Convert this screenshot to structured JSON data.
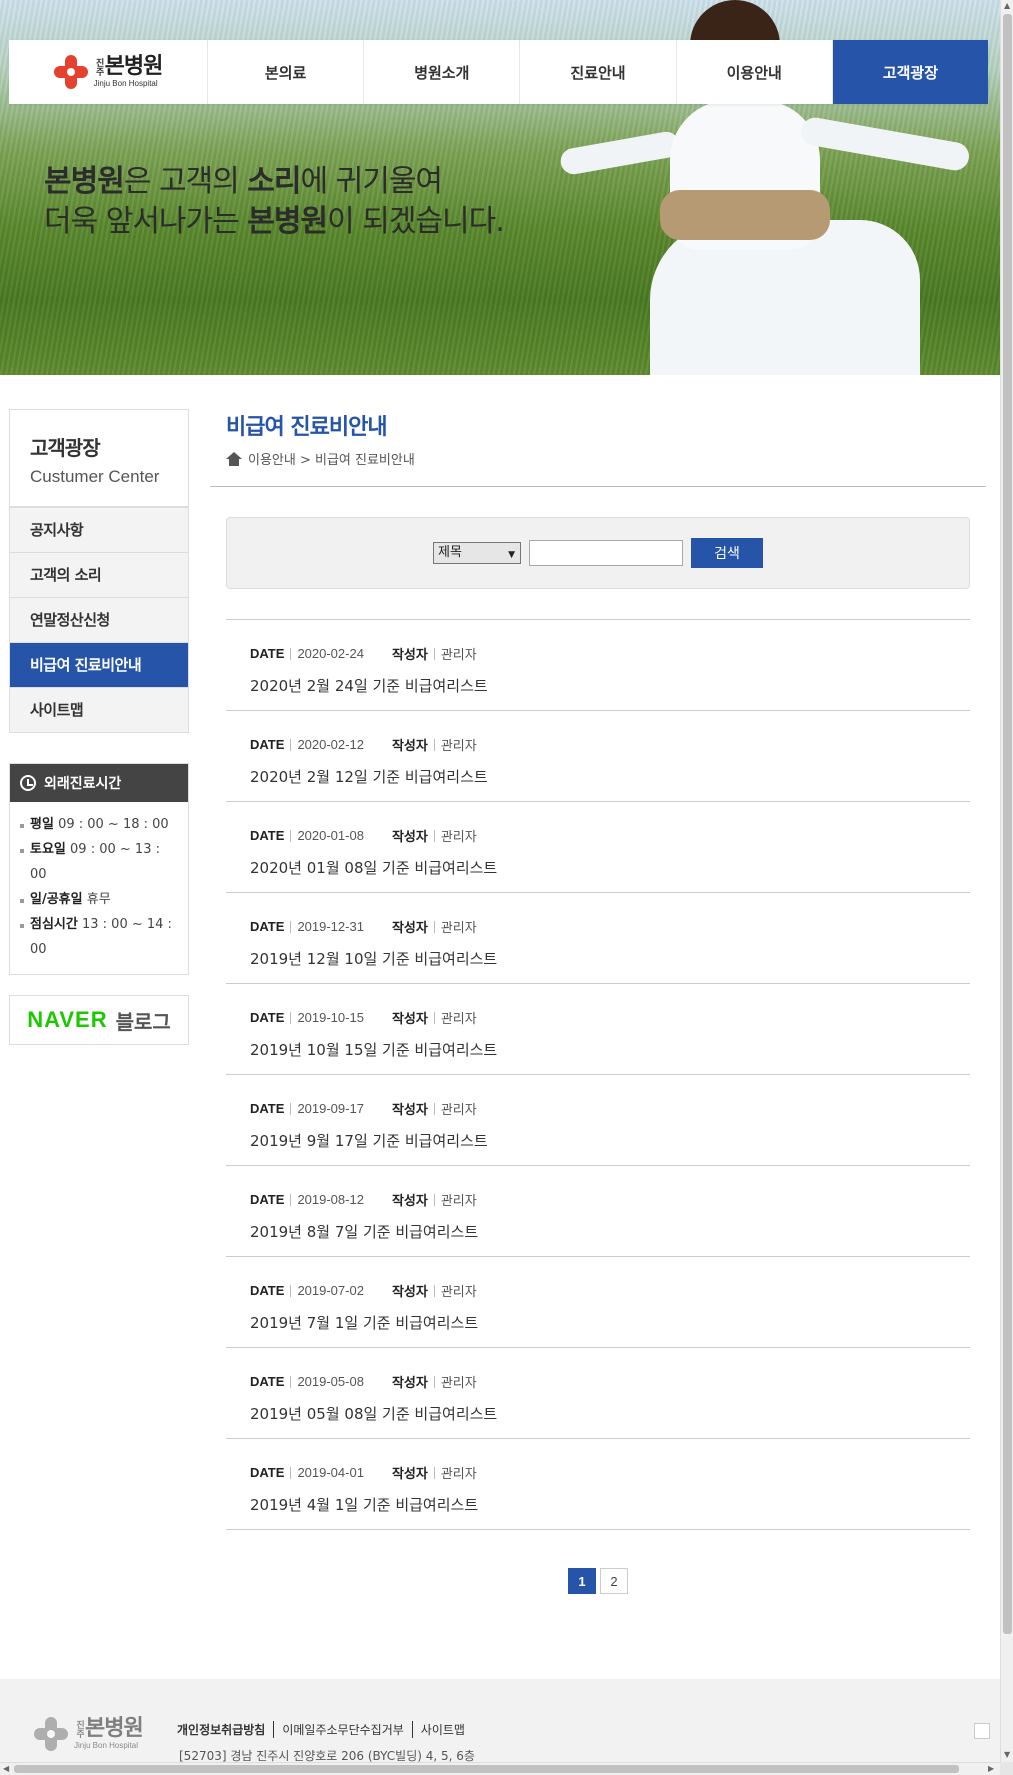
{
  "header": {
    "logo": {
      "name": "본병원",
      "prefix": "진주",
      "english": "Jinju Bon Hospital"
    },
    "nav": [
      "본의료",
      "병원소개",
      "진료안내",
      "이용안내",
      "고객광장"
    ],
    "active_nav": "고객광장"
  },
  "hero": {
    "line1_b1": "본병원",
    "line1_t1": "은 고객의 ",
    "line1_b2": "소리",
    "line1_t2": "에 귀기울여",
    "line2_t1": "더욱 앞서나가는 ",
    "line2_b1": "본병원",
    "line2_t2": "이 되겠습니다."
  },
  "sidebar": {
    "title_ko": "고객광장",
    "title_en": "Custumer Center",
    "items": [
      "공지사항",
      "고객의 소리",
      "연말정산신청",
      "비급여 진료비안내",
      "사이트맵"
    ],
    "active": "비급여 진료비안내",
    "hours": {
      "title": "외래진료시간",
      "rows": [
        {
          "label": "평일",
          "value": "09 : 00 ~ 18 : 00"
        },
        {
          "label": "토요일",
          "value": "09 : 00 ~ 13 : 00"
        },
        {
          "label": "일/공휴일",
          "value": "휴무"
        },
        {
          "label": "점심시간",
          "value": "13 : 00 ~ 14 : 00"
        }
      ]
    },
    "naver": {
      "brand": "NAVER",
      "label": "블로그"
    }
  },
  "content": {
    "title": "비급여 진료비안내",
    "breadcrumb": "이용안내 > 비급여 진료비안내",
    "search": {
      "select_value": "제목",
      "input_value": "",
      "button": "검색"
    },
    "meta_labels": {
      "date": "DATE",
      "author": "작성자"
    },
    "posts": [
      {
        "date": "2020-02-24",
        "author": "관리자",
        "title": "2020년 2월 24일 기준 비급여리스트"
      },
      {
        "date": "2020-02-12",
        "author": "관리자",
        "title": "2020년 2월 12일 기준 비급여리스트"
      },
      {
        "date": "2020-01-08",
        "author": "관리자",
        "title": "2020년 01월 08일 기준 비급여리스트"
      },
      {
        "date": "2019-12-31",
        "author": "관리자",
        "title": "2019년 12월 10일 기준 비급여리스트"
      },
      {
        "date": "2019-10-15",
        "author": "관리자",
        "title": "2019년 10월 15일 기준 비급여리스트"
      },
      {
        "date": "2019-09-17",
        "author": "관리자",
        "title": "2019년 9월 17일 기준 비급여리스트"
      },
      {
        "date": "2019-08-12",
        "author": "관리자",
        "title": "2019년 8월 7일 기준 비급여리스트"
      },
      {
        "date": "2019-07-02",
        "author": "관리자",
        "title": "2019년 7월 1일 기준 비급여리스트"
      },
      {
        "date": "2019-05-08",
        "author": "관리자",
        "title": "2019년 05월 08일 기준 비급여리스트"
      },
      {
        "date": "2019-04-01",
        "author": "관리자",
        "title": "2019년 4월 1일 기준 비급여리스트"
      }
    ],
    "pages": [
      "1",
      "2"
    ],
    "current_page": "1"
  },
  "footer": {
    "links": [
      "개인정보취급방침",
      "이메일주소무단수집거부",
      "사이트맵"
    ],
    "address": "[52703] 경남 진주시 진양호로 206 (BYC빌딩) 4, 5, 6층"
  },
  "colors": {
    "brand_blue": "#2654a8",
    "logo_red": "#e5412f",
    "naver_green": "#1ec800"
  }
}
